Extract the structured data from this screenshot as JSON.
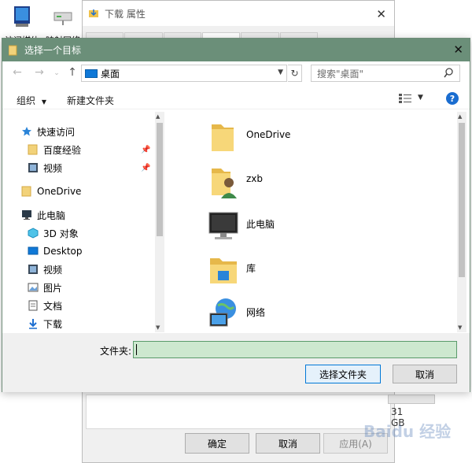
{
  "desktop": {
    "icons": [
      {
        "label": "访问媒体"
      },
      {
        "label": "映射网络"
      }
    ]
  },
  "background_dialog": {
    "title": "下载 属性",
    "size_text": "31 GB",
    "buttons": {
      "ok": "确定",
      "cancel": "取消",
      "apply": "应用(A)"
    }
  },
  "dialog": {
    "title": "选择一个目标",
    "address": {
      "location": "桌面"
    },
    "search": {
      "placeholder": "搜索\"桌面\""
    },
    "toolbar": {
      "organize": "组织",
      "new_folder": "新建文件夹"
    },
    "nav": {
      "quick_access": "快速访问",
      "baidu_exp": "百度经验",
      "videos_quick": "视频",
      "onedrive": "OneDrive",
      "this_pc": "此电脑",
      "objects_3d": "3D 对象",
      "desktop": "Desktop",
      "videos": "视频",
      "pictures": "图片",
      "documents": "文档",
      "downloads": "下载"
    },
    "items": [
      {
        "name": "OneDrive",
        "icon": "folder-icon"
      },
      {
        "name": "zxb",
        "icon": "user-folder-icon"
      },
      {
        "name": "此电脑",
        "icon": "computer-icon"
      },
      {
        "name": "库",
        "icon": "library-icon"
      },
      {
        "name": "网络",
        "icon": "network-icon"
      }
    ],
    "folder_label": "文件夹:",
    "folder_value": "",
    "buttons": {
      "select": "选择文件夹",
      "cancel": "取消"
    }
  },
  "watermark": "Baidu 经验",
  "colors": {
    "titlebar": "#6b8f79",
    "input_bg": "#cde8cf",
    "accent": "#0078d7"
  }
}
